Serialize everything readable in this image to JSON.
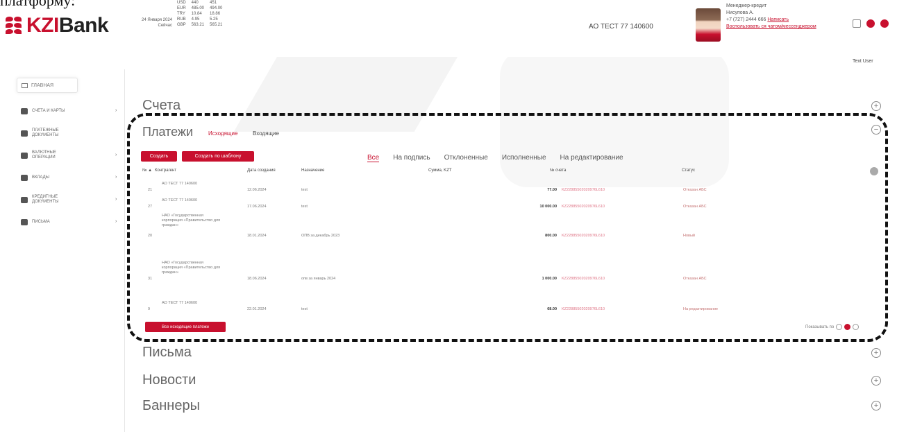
{
  "caption": "платформу:",
  "header": {
    "logo": {
      "prefix": "KZI",
      "suffix": "Bank"
    },
    "rates_date": "24 Января 2024",
    "rates_time": "Сейчас",
    "rates": [
      {
        "cur": "USD",
        "buy": "440",
        "sell": "451"
      },
      {
        "cur": "EUR",
        "buy": "485.00",
        "sell": "494.00"
      },
      {
        "cur": "TRY",
        "buy": "10.84",
        "sell": "18.86"
      },
      {
        "cur": "RUB",
        "buy": "4.95",
        "sell": "5.25"
      },
      {
        "cur": "GBP",
        "buy": "563.21",
        "sell": "565.21"
      }
    ],
    "org_name": "АО ТЕСТ 77 140600",
    "user_role": "Менеджер-кредит",
    "user_name": "Нисупова А.",
    "user_phone": "+7 (727) 2444 666",
    "user_link1": "Написать",
    "user_link2": "Воспользовать ся чатом/мессенджером",
    "text_user": "Text User"
  },
  "sidebar": {
    "home": "ГЛАВНАЯ",
    "items": [
      {
        "label": "СЧЕТА И КАРТЫ",
        "has_arrow": true
      },
      {
        "label": "ПЛАТЕЖНЫЕ ДОКУМЕНТЫ",
        "has_arrow": false
      },
      {
        "label": "ВАЛЮТНЫЕ ОПЕРАЦИИ",
        "has_arrow": true
      },
      {
        "label": "ВКЛАДЫ",
        "has_arrow": true
      },
      {
        "label": "КРЕДИТНЫЕ ДОКУМЕНТЫ",
        "has_arrow": true
      },
      {
        "label": "ПИСЬМА",
        "has_arrow": true
      }
    ]
  },
  "sections": {
    "accounts": "Счета",
    "payments": "Платежи",
    "letters": "Письма",
    "news": "Новости",
    "banners": "Баннеры"
  },
  "payments": {
    "tab_out": "Исходящие",
    "tab_in": "Входящие",
    "btn_create": "Создать",
    "btn_create_template": "Создать по шаблону",
    "filters": [
      "Все",
      "На подпись",
      "Отклоненные",
      "Исполненные",
      "На редактирование"
    ],
    "columns": [
      "№ ▲",
      "Контрагент",
      "Дата создания",
      "Назначение",
      "Сумма, KZT",
      "№ счета",
      "Статус"
    ],
    "rows": [
      {
        "num": "21",
        "counterparty": "АО ТЕСТ 77 140600",
        "date": "12.06.2024",
        "purpose": "test",
        "amount": "77.00",
        "account": "KZ22885502020976L610",
        "status": "Отказан АБС"
      },
      {
        "num": "27",
        "counterparty": "АО ТЕСТ 77 140600",
        "date": "17.06.2024",
        "purpose": "test",
        "amount": "10 000.00",
        "account": "KZ22885502020976L610",
        "status": "Отказан АБС"
      },
      {
        "num": "20",
        "counterparty": "НАО «Государственная корпорация «Правительство для граждан»",
        "date": "18.01.2024",
        "purpose": "ОПВ за декабрь 2023",
        "amount": "800.00",
        "account": "KZ22885502020976L610",
        "status": "Новый"
      },
      {
        "num": "31",
        "counterparty": "НАО «Государственная корпорация «Правительство для граждан»",
        "date": "18.06.2024",
        "purpose": "опв за январь 2024",
        "amount": "1 000.00",
        "account": "KZ22885502020976L610",
        "status": "Отказан АБС"
      },
      {
        "num": "9",
        "counterparty": "АО ТЕСТ 77 140600",
        "date": "22.01.2024",
        "purpose": "test",
        "amount": "68.00",
        "account": "KZ22885502020976L610",
        "status": "На редактирование"
      }
    ],
    "btn_all": "Все исходящие платежи",
    "pager_label": "Показывать по"
  },
  "colors": {
    "brand": "#c8102e"
  }
}
